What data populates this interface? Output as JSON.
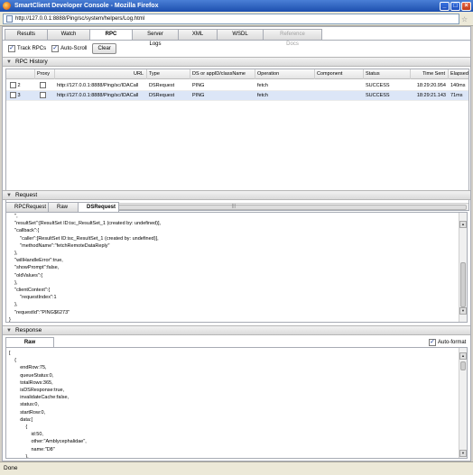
{
  "window": {
    "title": "SmartClient Developer Console - Mozilla Firefox"
  },
  "url": "http://127.0.0.1:8888/Ping/sc/system/helpers/Log.html",
  "tabs": [
    {
      "label": "Results"
    },
    {
      "label": "Watch"
    },
    {
      "label": "RPC"
    },
    {
      "label": "Server Logs"
    },
    {
      "label": "XML"
    },
    {
      "label": "WSDL"
    },
    {
      "label": "Reference Docs"
    }
  ],
  "toolbar": {
    "track_rpcs": "Track RPCs",
    "auto_scroll": "Auto-Scroll",
    "clear": "Clear"
  },
  "rpc_history": {
    "title": "RPC History",
    "columns": [
      "Proxy",
      "URL",
      "Type",
      "DS or appID/className",
      "Operation",
      "Component",
      "Status",
      "Time Sent",
      "Elapsed"
    ],
    "rows": [
      {
        "num": "2",
        "url": "http://127.0.0.1:8888/Ping/sc/IDACall",
        "type": "DSRequest",
        "ds": "PING",
        "op": "fetch",
        "component": "",
        "status": "SUCCESS",
        "time": "18:29:20.954",
        "elapsed": "140ms"
      },
      {
        "num": "3",
        "url": "http://127.0.0.1:8888/Ping/sc/IDACall",
        "type": "DSRequest",
        "ds": "PING",
        "op": "fetch",
        "component": "",
        "status": "SUCCESS",
        "time": "18:29:21.143",
        "elapsed": "71ms"
      }
    ]
  },
  "request": {
    "title": "Request",
    "subtabs": [
      "RPCRequest",
      "Raw",
      "DSRequest"
    ],
    "lines": [
      "    \",",
      "    \"resultSet\":[ResultSet ID:isc_ResultSet_1 (created by: undefined)],",
      "    \"callback\":{",
      "        \"caller\":[ResultSet ID:isc_ResultSet_1 (created by: undefined)],",
      "        \"methodName\":\"fetchRemoteDataReply\"",
      "    },",
      "    \"willHandleError\":true,",
      "    \"showPrompt\":false,",
      "    \"oldValues\":{",
      "    },",
      "    \"clientContext\":{",
      "        \"requestIndex\":1",
      "    },",
      "    \"requestId\":\"PING$6273\"",
      "}"
    ]
  },
  "response": {
    "title": "Response",
    "subtab": "Raw",
    "auto_format": "Auto-format",
    "lines": [
      "[",
      "    {",
      "        endRow:75,",
      "        queueStatus:0,",
      "        totalRows:365,",
      "        isDSResponse:true,",
      "        invalidateCache:false,",
      "        status:0,",
      "        startRow:0,",
      "        data:[",
      "            {",
      "                id:50,",
      "                other:\"Amblycephalidae\",",
      "                name:\"D8\"",
      "            },"
    ]
  },
  "status": "Done"
}
